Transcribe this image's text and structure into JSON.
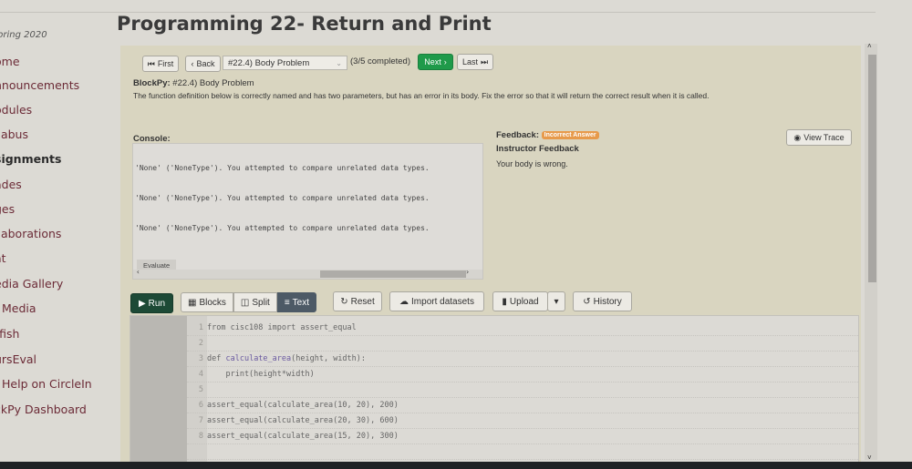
{
  "sidebar": {
    "term": "pring 2020",
    "items": [
      {
        "label": "ome"
      },
      {
        "label": "nnouncements"
      },
      {
        "label": "odules"
      },
      {
        "label": "llabus"
      },
      {
        "label": "signments",
        "active": true
      },
      {
        "label": "ades"
      },
      {
        "label": "ges"
      },
      {
        "label": "llaborations"
      },
      {
        "label": "at"
      },
      {
        "label": "edia Gallery"
      },
      {
        "label": "Media"
      },
      {
        "label": "rfish"
      },
      {
        "label": "ursEval"
      },
      {
        "label": "Help on CircleIn"
      },
      {
        "label": "ckPy Dashboard"
      }
    ]
  },
  "page_title": "Programming 22- Return and Print",
  "nav": {
    "first": "First",
    "back": "Back",
    "problem_select": "#22.4) Body Problem",
    "completed": "(3/5 completed)",
    "next": "Next",
    "last": "Last"
  },
  "problem": {
    "prefix": "BlockPy:",
    "title": "#22.4) Body Problem",
    "description": "The function definition below is correctly named and has two parameters, but has an error in its body. Fix the error so that it will return the correct result when it is called."
  },
  "console": {
    "label": "Console:",
    "lines": [
      "'None' ('NoneType'). You attempted to compare unrelated data types.",
      "'None' ('NoneType'). You attempted to compare unrelated data types.",
      "'None' ('NoneType'). You attempted to compare unrelated data types."
    ],
    "evaluate": "Evaluate"
  },
  "feedback": {
    "label": "Feedback:",
    "badge": "Incorrect Answer",
    "badge_color": "#e79a4b",
    "instructor_label": "Instructor Feedback",
    "message": "Your body is wrong.",
    "view_trace": "View Trace"
  },
  "toolbar": {
    "run": "Run",
    "blocks": "Blocks",
    "split": "Split",
    "text": "Text",
    "active_mode": "Text",
    "reset": "Reset",
    "import": "Import datasets",
    "upload": "Upload",
    "history": "History",
    "run_color": "#1d4a36",
    "next_color": "#1f9a4a"
  },
  "code": {
    "lines": [
      {
        "n": "1",
        "pre": "from cisc108 import assert_equal",
        "fn": "",
        "post": ""
      },
      {
        "n": "2",
        "pre": "",
        "fn": "",
        "post": ""
      },
      {
        "n": "3",
        "pre": "def ",
        "fn": "calculate_area",
        "post": "(height, width):"
      },
      {
        "n": "4",
        "pre": "    print(height*width)",
        "fn": "",
        "post": ""
      },
      {
        "n": "5",
        "pre": "",
        "fn": "",
        "post": ""
      },
      {
        "n": "6",
        "pre": "assert_equal(calculate_area(10, 20), 200)",
        "fn": "",
        "post": ""
      },
      {
        "n": "7",
        "pre": "assert_equal(calculate_area(20, 30), 600)",
        "fn": "",
        "post": ""
      },
      {
        "n": "8",
        "pre": "assert_equal(calculate_area(15, 20), 300)",
        "fn": "",
        "post": ""
      }
    ]
  }
}
